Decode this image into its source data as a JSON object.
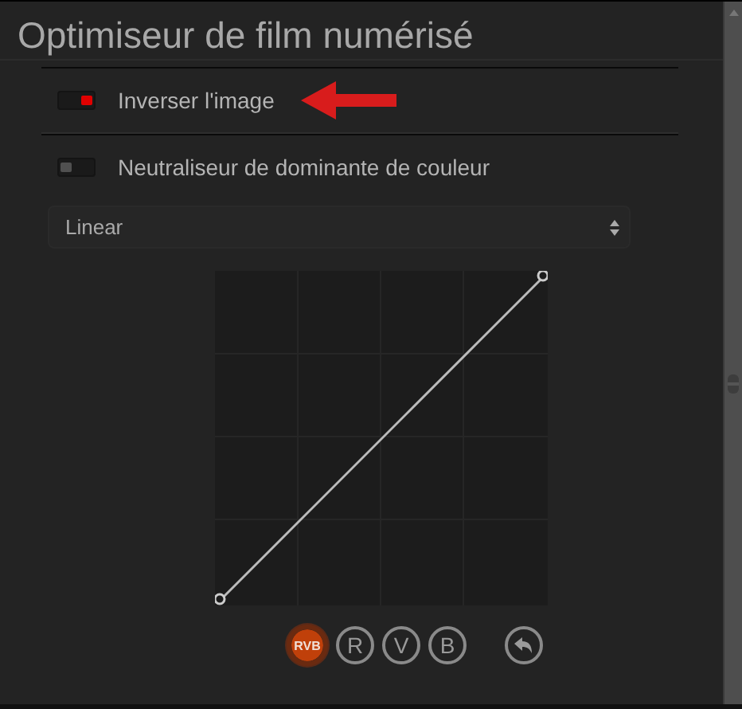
{
  "panel": {
    "title": "Optimiseur de film numérisé"
  },
  "toggles": [
    {
      "label": "Inverser l'image",
      "on": true
    },
    {
      "label": "Neutraliseur de dominante de couleur",
      "on": false
    }
  ],
  "select": {
    "value": "Linear"
  },
  "channels": [
    {
      "label": "RVB",
      "selected": true
    },
    {
      "label": "R",
      "selected": false
    },
    {
      "label": "V",
      "selected": false
    },
    {
      "label": "B",
      "selected": false
    }
  ]
}
